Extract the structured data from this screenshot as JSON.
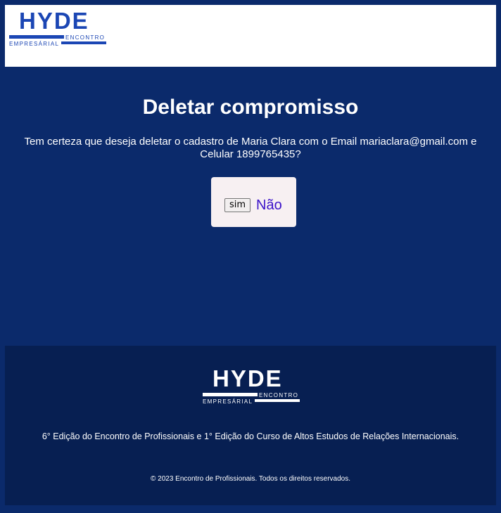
{
  "header": {
    "logo": {
      "main": "HYDE",
      "top_small": "ENCONTRO",
      "bottom_small": "EMPRESÁRIAL"
    }
  },
  "main": {
    "title": "Deletar compromisso",
    "message": "Tem certeza que deseja deletar o cadastro de Maria Clara com o Email mariaclara@gmail.com e Celular 1899765435?",
    "confirm_label": "sim",
    "cancel_label": "Não"
  },
  "footer": {
    "logo": {
      "main": "HYDE",
      "top_small": "ENCONTRO",
      "bottom_small": "EMPRESÁRIAL"
    },
    "description": "6° Edição do Encontro de Profissionais e 1° Edição do Curso de Altos Estudos de Relações Internacionais.",
    "copyright": "© 2023 Encontro de Profissionais. Todos os direitos reservados."
  },
  "colors": {
    "page_background": "#0b2a6b",
    "footer_background": "#071f52",
    "logo_blue": "#1b46b4",
    "card_background": "#f7f0f2",
    "link_color": "#3b12c9"
  }
}
